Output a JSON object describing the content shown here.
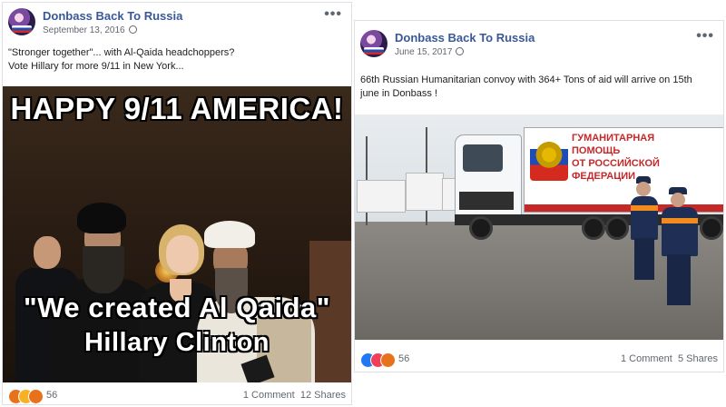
{
  "posts": [
    {
      "page_name": "Donbass Back To Russia",
      "date": "September 13, 2016",
      "text_line1": "\"Stronger together\"... with Al-Qaida headchoppers?",
      "text_line2": "Vote Hillary for more 9/11 in New York...",
      "image": {
        "caption_top": "HAPPY 9/11 AMERICA!",
        "caption_quote": "\"We created Al Qaida\"",
        "caption_attribution": "Hillary Clinton"
      },
      "reactions": {
        "icons": [
          "angry-icon",
          "wow-icon",
          "angry-icon"
        ],
        "count": "56"
      },
      "comments": "1 Comment",
      "shares": "12 Shares"
    },
    {
      "page_name": "Donbass Back To Russia",
      "date": "June 15, 2017",
      "text_line1": "66th Russian Humanitarian convoy with 364+ Tons of aid will arrive on 15th",
      "text_line2": "june in Donbass !",
      "image": {
        "banner_line1": "ГУМАНИТАРНАЯ",
        "banner_line2": "ПОМОЩЬ",
        "banner_line3": "ОТ РОССИЙСКОЙ",
        "banner_line4": "ФЕДЕРАЦИИ"
      },
      "reactions": {
        "icons": [
          "like-icon",
          "love-icon",
          "angry-icon"
        ],
        "count": "56"
      },
      "comments": "1 Comment",
      "shares": "5 Shares"
    }
  ],
  "colors": {
    "link_blue": "#385898",
    "like_blue": "#2078f4",
    "love_red": "#f33e58",
    "angry_orange": "#e8711c"
  }
}
